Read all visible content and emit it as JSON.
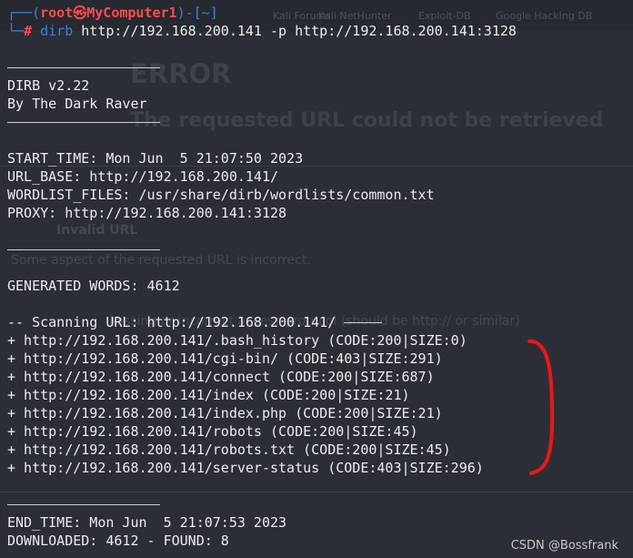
{
  "prompt": {
    "open": "┌──(",
    "user_host": "root㉿MyComputer1",
    "dir_part": ")-[~]",
    "hash_prefix": "└─",
    "hash": "#",
    "command": "dirb",
    "args": "http://192.168.200.141 -p http://192.168.200.141:3128"
  },
  "banner": {
    "version": "DIRB v2.22",
    "author": "By The Dark Raver"
  },
  "info": {
    "start_time": "START_TIME: Mon Jun  5 21:07:50 2023",
    "url_base": "URL_BASE: http://192.168.200.141/",
    "wordlist": "WORDLIST_FILES: /usr/share/dirb/wordlists/common.txt",
    "proxy": "PROXY: http://192.168.200.141:3128"
  },
  "generated": "GENERATED WORDS: 4612",
  "scanning": "-- Scanning URL: http://192.168.200.141/",
  "results": [
    "+ http://192.168.200.141/.bash_history (CODE:200|SIZE:0)",
    "+ http://192.168.200.141/cgi-bin/ (CODE:403|SIZE:291)",
    "+ http://192.168.200.141/connect (CODE:200|SIZE:687)",
    "+ http://192.168.200.141/index (CODE:200|SIZE:21)",
    "+ http://192.168.200.141/index.php (CODE:200|SIZE:21)",
    "+ http://192.168.200.141/robots (CODE:200|SIZE:45)",
    "+ http://192.168.200.141/robots.txt (CODE:200|SIZE:45)",
    "+ http://192.168.200.141/server-status (CODE:403|SIZE:296)"
  ],
  "end": {
    "end_time": "END_TIME: Mon Jun  5 21:07:53 2023",
    "downloaded": "DOWNLOADED: 4612 - FOUND: 8"
  },
  "watermark": "CSDN @Bossfrank",
  "background_page": {
    "tabs": [
      "Kali Forums",
      "Kali NetHunter",
      "Exploit-DB",
      "Google Hacking DB"
    ],
    "error_title": "ERROR",
    "error_subtitle": "The requested URL could not be retrieved",
    "invalid_url": "Invalid URL",
    "aspect_text": "Some aspect of the requested URL is incorrect.",
    "protocol_text": "Missing or incorrect access protocol (should be http:// or similar)"
  },
  "colors": {
    "terminal_bg": "#2b2e36",
    "prompt_blue": "#3f7fe0",
    "prompt_red": "#ff4b4b",
    "text": "#ececec",
    "annotation_red": "#e81818"
  }
}
